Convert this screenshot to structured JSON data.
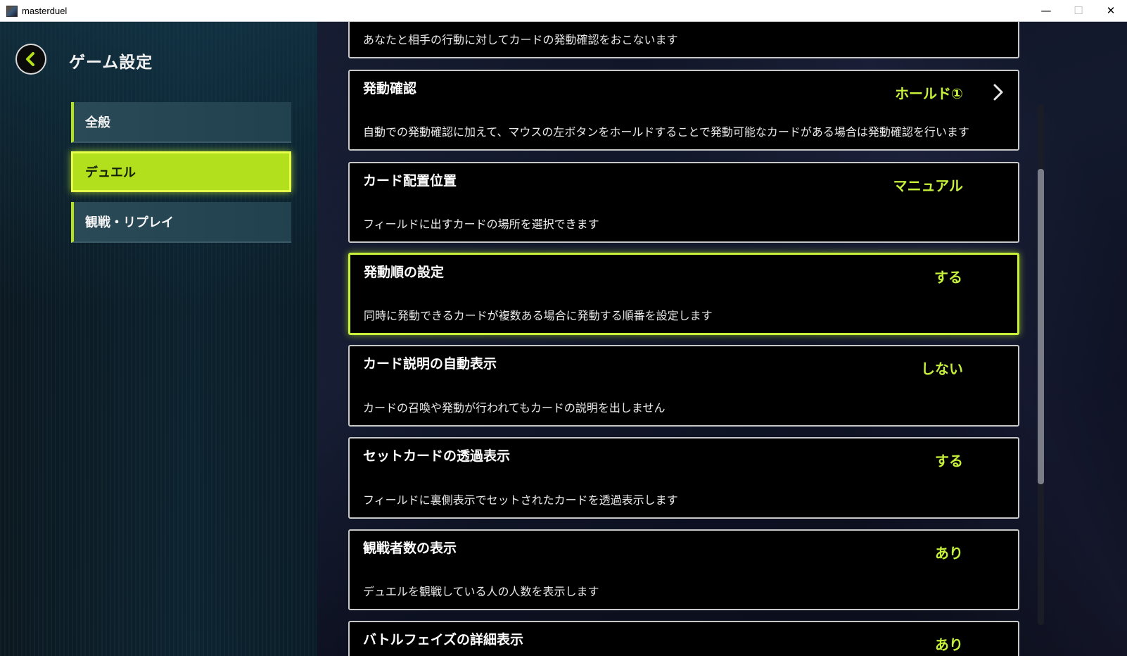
{
  "window": {
    "title": "masterduel",
    "minimize_glyph": "—",
    "maximize_glyph": "☐",
    "close_glyph": "✕"
  },
  "header": {
    "title": "ゲーム設定"
  },
  "sidebar": {
    "items": [
      {
        "label": "全般",
        "active": false
      },
      {
        "label": "デュエル",
        "active": true
      },
      {
        "label": "観戦・リプレイ",
        "active": false
      }
    ]
  },
  "settings": [
    {
      "title": "",
      "value": "",
      "desc": "あなたと相手の行動に対してカードの発動確認をおこないます"
    },
    {
      "title": "発動確認",
      "value": "ホールド①",
      "desc": "自動での発動確認に加えて、マウスの左ボタンをホールドすることで発動可能なカードがある場合は発動確認を行います",
      "has_chevron": true
    },
    {
      "title": "カード配置位置",
      "value": "マニュアル",
      "desc": "フィールドに出すカードの場所を選択できます"
    },
    {
      "title": "発動順の設定",
      "value": "する",
      "desc": "同時に発動できるカードが複数ある場合に発動する順番を設定します",
      "highlighted": true
    },
    {
      "title": "カード説明の自動表示",
      "value": "しない",
      "desc": "カードの召喚や発動が行われてもカードの説明を出しません"
    },
    {
      "title": "セットカードの透過表示",
      "value": "する",
      "desc": "フィールドに裏側表示でセットされたカードを透過表示します"
    },
    {
      "title": "観戦者数の表示",
      "value": "あり",
      "desc": "デュエルを観戦している人の人数を表示します"
    },
    {
      "title": "バトルフェイズの詳細表示",
      "value": "あり",
      "desc": ""
    }
  ],
  "colors": {
    "accent": "#c6f03a",
    "active_nav": "#b3e01c"
  }
}
